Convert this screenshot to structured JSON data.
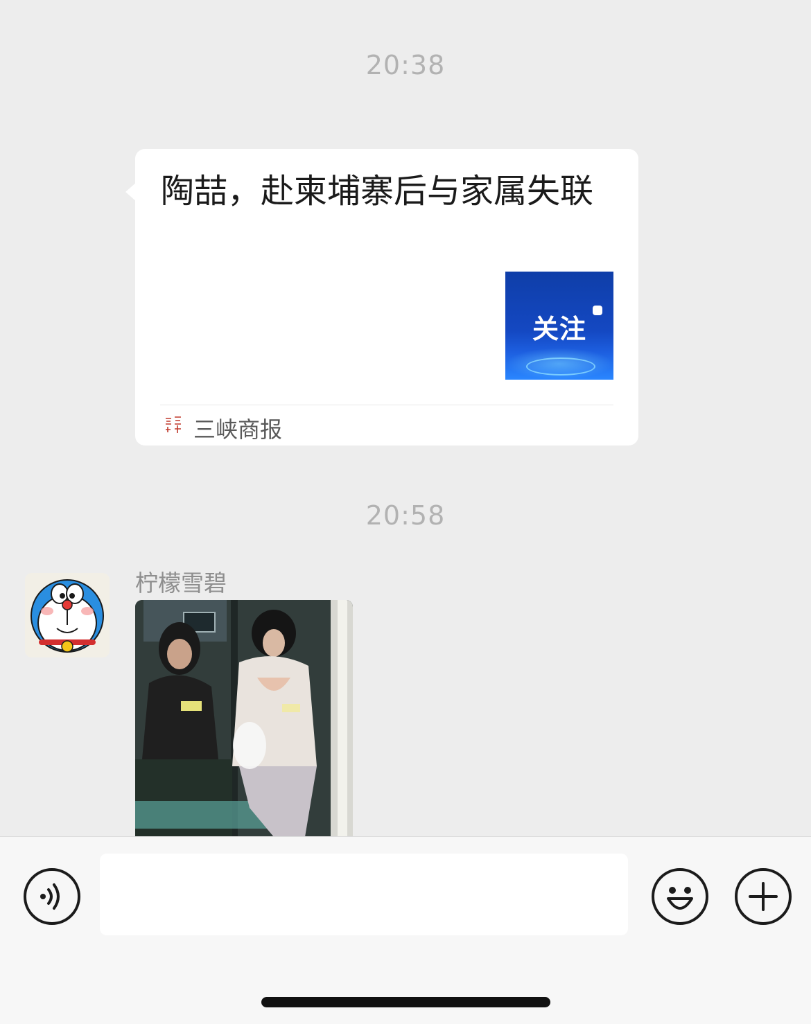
{
  "chat": {
    "timestamps": [
      "20:38",
      "20:58"
    ],
    "article": {
      "title": "陶喆，赴柬埔寨后与家属失联",
      "thumbnail_text": "关注",
      "source_name": "三峡商报",
      "source_logo_icon": "sanxia-shangbao-logo-icon"
    },
    "message": {
      "sender": "柠檬雪碧",
      "avatar_icon": "doraemon-avatar-icon",
      "content_type": "image"
    }
  },
  "input_bar": {
    "voice_icon": "voice-icon",
    "emoji_icon": "emoji-icon",
    "plus_icon": "plus-icon",
    "text_value": ""
  },
  "colors": {
    "background": "#ededed",
    "bubble": "#ffffff",
    "thumbnail_blue": "#1448c2",
    "timestamp": "#b2b2b2"
  }
}
